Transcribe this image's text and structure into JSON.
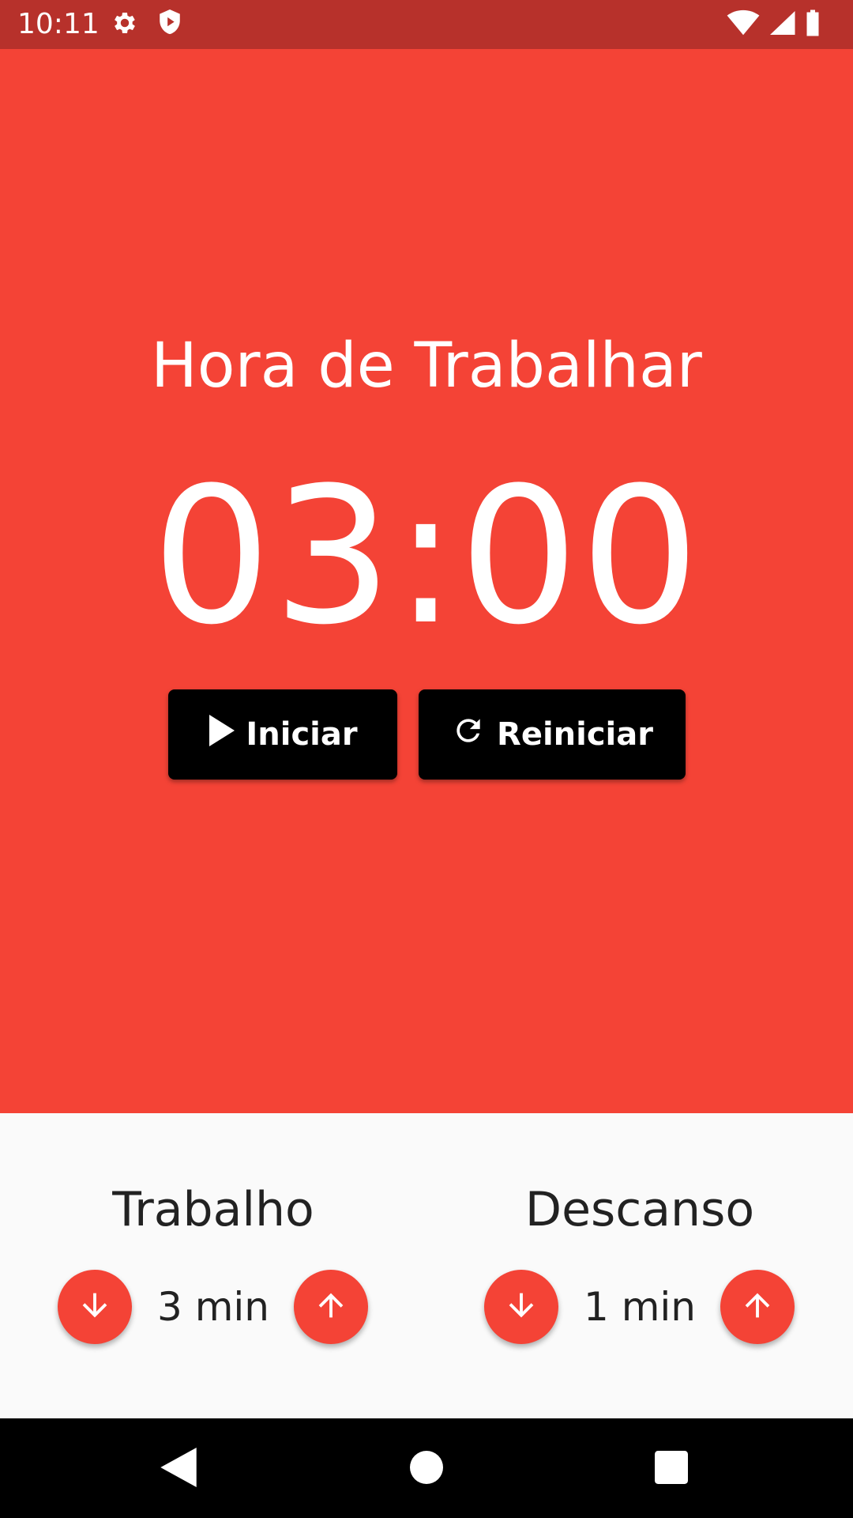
{
  "status_bar": {
    "time": "10:11",
    "left_icons": [
      "gear-icon",
      "shield-play-icon"
    ],
    "right_icons": [
      "wifi-icon",
      "signal-icon",
      "battery-icon"
    ],
    "background": "#b7312b"
  },
  "timer": {
    "mode_title": "Hora de Trabalhar",
    "display": "03:00",
    "background": "#f44336",
    "start_label": "Iniciar",
    "start_icon": "play-icon",
    "reset_label": "Reiniciar",
    "reset_icon": "refresh-icon"
  },
  "settings": {
    "work": {
      "title": "Trabalho",
      "value": "3 min",
      "decrease_icon": "arrow-down-icon",
      "increase_icon": "arrow-up-icon"
    },
    "rest": {
      "title": "Descanso",
      "value": "1 min",
      "decrease_icon": "arrow-down-icon",
      "increase_icon": "arrow-up-icon"
    },
    "accent": "#f44336",
    "background": "#fafafa"
  },
  "nav_bar": {
    "icons": [
      "back-icon",
      "home-icon",
      "recents-icon"
    ]
  }
}
